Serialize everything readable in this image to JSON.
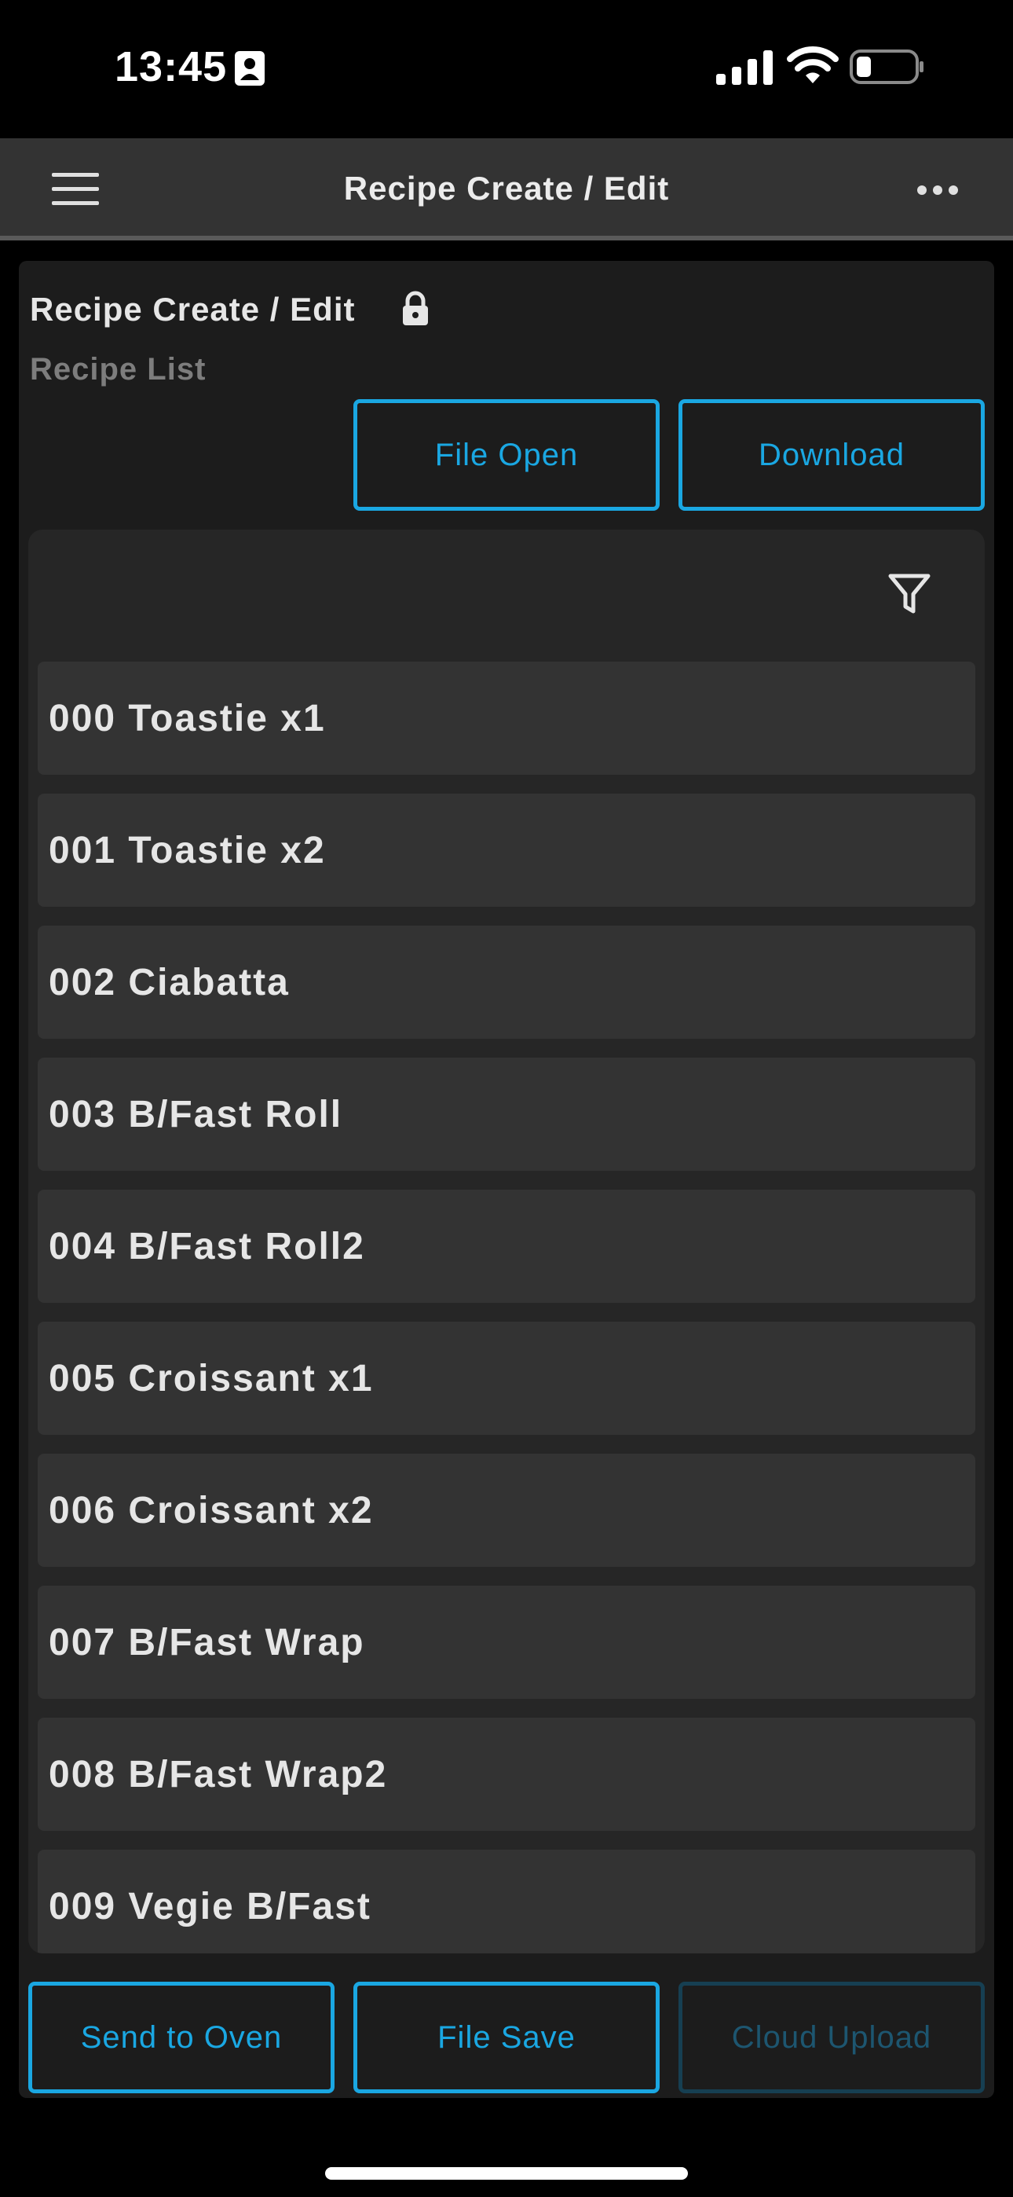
{
  "status_bar": {
    "time": "13:45",
    "icons": [
      "contact-card-icon",
      "cellular-signal-icon",
      "wifi-icon",
      "battery-icon"
    ]
  },
  "app_bar": {
    "title": "Recipe Create / Edit",
    "menu_icon": "hamburger-menu-icon",
    "more_icon": "more-horizontal-icon"
  },
  "section": {
    "title": "Recipe Create / Edit",
    "lock_icon": "lock-icon",
    "subtitle": "Recipe List"
  },
  "top_buttons": {
    "file_open": "File Open",
    "download": "Download"
  },
  "recipe_list": {
    "filter_icon": "filter-icon",
    "items": [
      "000 Toastie x1",
      "001 Toastie x2",
      "002 Ciabatta",
      "003 B/Fast Roll",
      "004 B/Fast Roll2",
      "005 Croissant x1",
      "006 Croissant x2",
      "007 B/Fast Wrap",
      "008 B/Fast Wrap2",
      "009 Vegie B/Fast"
    ]
  },
  "bottom_buttons": {
    "send_to_oven": "Send to Oven",
    "file_save": "File Save",
    "cloud_upload": "Cloud Upload"
  },
  "colors": {
    "accent": "#1aa7e2",
    "accent_disabled": "#1d5670",
    "background": "#000000",
    "app_bar": "#333333",
    "panel": "#1c1c1c",
    "list_card": "#262626",
    "list_item": "#333333",
    "subtitle_text": "#7d7d7d"
  }
}
